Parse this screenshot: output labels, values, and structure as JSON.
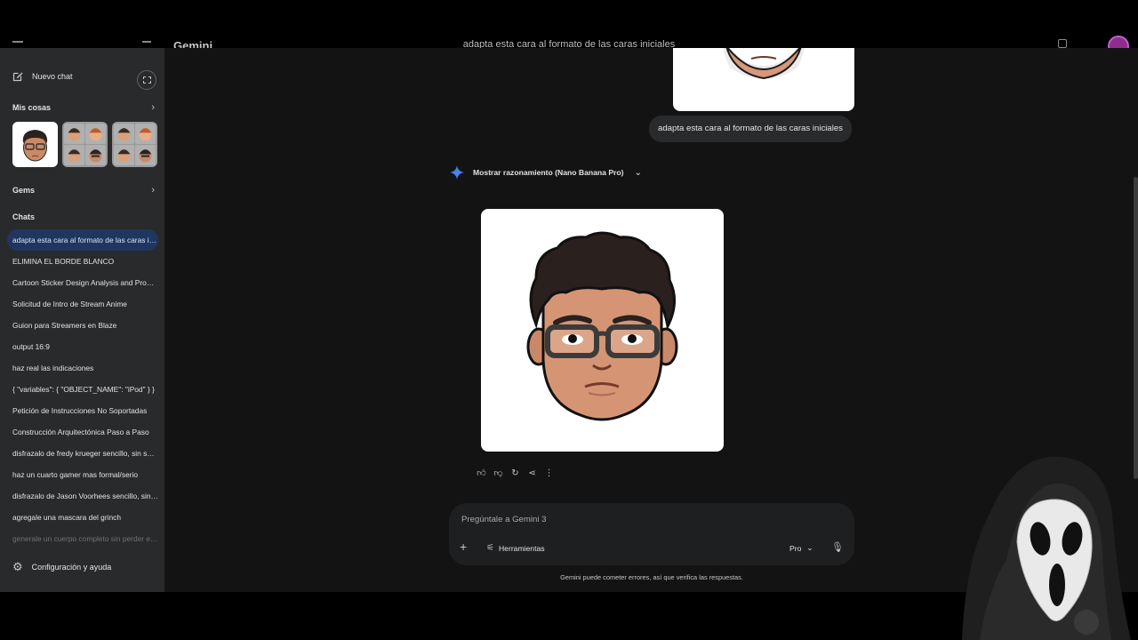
{
  "topbar": {
    "app_name": "Gemini",
    "conversation_title": "adapta esta cara al formato de las caras iniciales"
  },
  "sidebar": {
    "new_chat_label": "Nuevo chat",
    "my_stuff_label": "Mis cosas",
    "gems_label": "Gems",
    "chats_label": "Chats",
    "chats": [
      "adapta esta cara al formato de las caras iniciales",
      "ELIMINA EL BORDE BLANCO",
      "Cartoon Sticker Design Analysis and Prompt",
      "Solicitud de Intro de Stream Anime",
      "Guion para Streamers en Blaze",
      "output 16:9",
      "haz real las indicaciones",
      "{ \"variables\": { \"OBJECT_NAME\": \"iPod\" } }",
      "Petición de Instrucciones No Soportadas",
      "Construcción Arquitectónica Paso a Paso",
      "disfrazalo de fredy krueger sencillo, sin sombrero",
      "haz un cuarto gamer mas formal/serio",
      "disfrazalo de Jason Voorhees sencillo, sin mascara",
      "agregale una mascara del grinch",
      "generale un cuerpo completo sin perder estilo"
    ],
    "settings_label": "Configuración y ayuda"
  },
  "conversation": {
    "user_message": "adapta esta cara al formato de las caras iniciales",
    "reasoning_label": "Mostrar razonamiento (Nano Banana Pro)"
  },
  "composer": {
    "placeholder": "Pregúntale a Gemini 3",
    "tools_label": "Herramientas",
    "model_label": "Pro"
  },
  "disclaimer": "Gemini puede cometer errores, así que verifica las respuestas.",
  "colors": {
    "sidebar_bg": "#282a2c",
    "main_bg": "#131314",
    "active_chat_bg": "#1f3760",
    "accent_blue": "#4285f4"
  },
  "icons": {
    "new_chat": "edit-square-icon",
    "toggle": "sidebar-toggle-icon",
    "settings": "gear-icon",
    "reasoning": "gemini-spark-icon",
    "actions": [
      "thumbs-up-icon",
      "thumbs-down-icon",
      "regenerate-icon",
      "share-icon",
      "more-vert-icon"
    ],
    "composer": [
      "plus-icon",
      "tools-icon",
      "chevron-down-icon",
      "mic-icon"
    ]
  }
}
